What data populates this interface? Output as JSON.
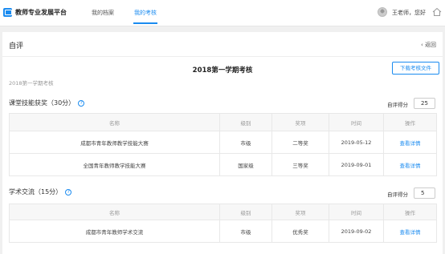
{
  "header": {
    "app_title": "教师专业发展平台",
    "nav": [
      {
        "label": "我的档案",
        "active": false
      },
      {
        "label": "我的考核",
        "active": true
      }
    ],
    "greeting": "王老师，您好"
  },
  "panel": {
    "title": "自评",
    "back_label": "返回",
    "exam_title": "2018第一学期考核",
    "download_label": "下载考核文件",
    "semester": "2018第一学期考核"
  },
  "columns": [
    "名称",
    "级别",
    "奖项",
    "时间",
    "操作"
  ],
  "sections": [
    {
      "title": "课堂技能获奖（30分）",
      "score_label": "自评得分",
      "score_value": "25",
      "rows": [
        {
          "name": "成都市青年教师教学技能大赛",
          "level": "市级",
          "award": "二等奖",
          "date": "2019-05-12",
          "action": "查看详情"
        },
        {
          "name": "全国青年教师教学技能大赛",
          "level": "国家级",
          "award": "三等奖",
          "date": "2019-09-01",
          "action": "查看详情"
        }
      ]
    },
    {
      "title": "学术交流（15分）",
      "score_label": "自评得分",
      "score_value": "5",
      "rows": [
        {
          "name": "成都市青年教师学术交流",
          "level": "市级",
          "award": "优秀奖",
          "date": "2019-09-02",
          "action": "查看详情"
        }
      ]
    }
  ],
  "colors": {
    "accent": "#1a8bf0",
    "background": "#f0f0f0"
  },
  "icons": [
    "logo-icon",
    "help-icon",
    "chevron-left-icon",
    "home-icon",
    "avatar"
  ]
}
